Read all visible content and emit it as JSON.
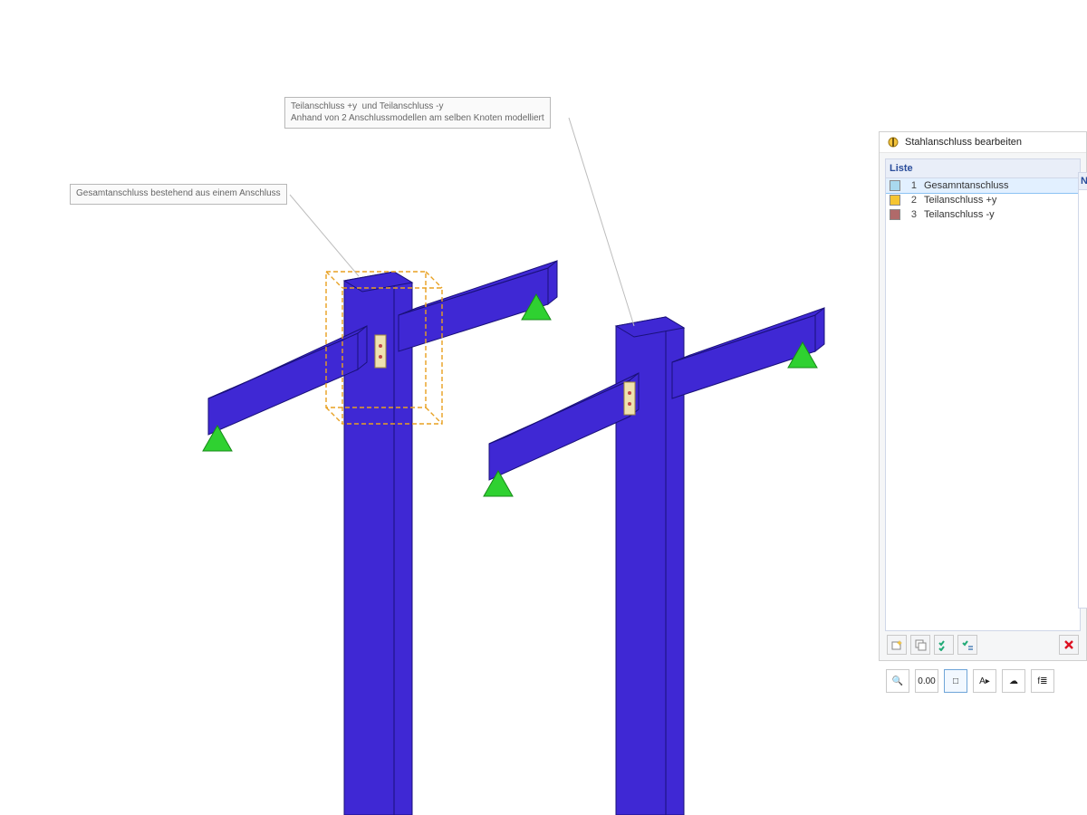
{
  "panel": {
    "title": "Stahlanschluss bearbeiten",
    "list_header": "Liste",
    "right_stub_header": "N",
    "items": [
      {
        "index": "1",
        "label": "Gesamntanschluss",
        "color": "#a9d9ee",
        "selected": true
      },
      {
        "index": "2",
        "label": "Teilanschluss +y",
        "color": "#f5c531",
        "selected": false
      },
      {
        "index": "3",
        "label": "Teilanschluss -y",
        "color": "#b06a6a",
        "selected": false
      }
    ],
    "list_buttons": [
      {
        "name": "new-item-button",
        "glyph": "sparkle"
      },
      {
        "name": "duplicate-button",
        "glyph": "copy"
      },
      {
        "name": "check-all-button",
        "glyph": "checks"
      },
      {
        "name": "check-filter-button",
        "glyph": "checks2"
      },
      {
        "name": "delete-button",
        "glyph": "x",
        "danger": true
      }
    ]
  },
  "bottom_strip": [
    {
      "name": "search-icon-button",
      "label": "🔍"
    },
    {
      "name": "units-icon-button",
      "label": "0.00"
    },
    {
      "name": "view-rect-icon-button",
      "label": "□",
      "active": true
    },
    {
      "name": "tag-icon-button",
      "label": "A▸"
    },
    {
      "name": "cloud-icon-button",
      "label": "☁"
    },
    {
      "name": "function-icon-button",
      "label": "f≣"
    }
  ],
  "annotations": {
    "left": "Gesamtanschluss bestehend aus einem Anschluss",
    "right": "Teilanschluss +y  und Teilanschluss -y\nAnhand von 2 Anschlussmodellen am selben Knoten modelliert"
  },
  "colors": {
    "beam_fill": "#3f28d4",
    "beam_edge": "#1a117a",
    "support": "#2fd131",
    "select_box": "#e8a020"
  }
}
